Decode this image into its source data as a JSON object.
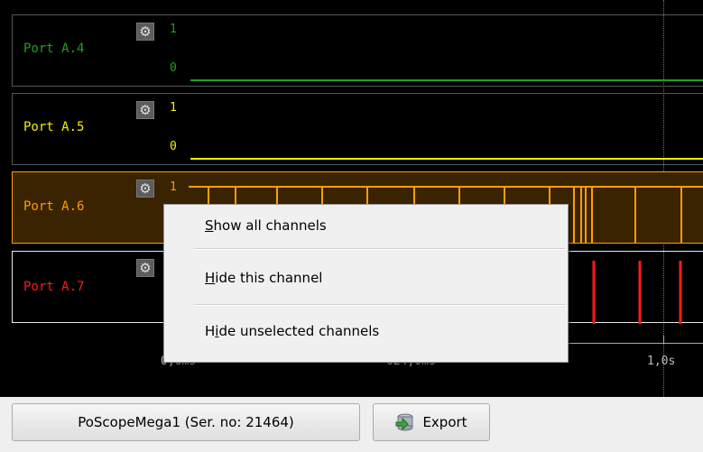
{
  "channels": [
    {
      "label": "Port A.4",
      "color": "#1f9f1f",
      "level_high": "1",
      "level_low": "0"
    },
    {
      "label": "Port A.5",
      "color": "#f0f000",
      "level_high": "1",
      "level_low": "0"
    },
    {
      "label": "Port A.6",
      "color": "#ff9f00",
      "level_high": "1"
    },
    {
      "label": "Port A.7",
      "color": "#ff1a1a"
    }
  ],
  "axis": {
    "tick_left": "0,0ms",
    "tick_mid": "624,0ms",
    "tick_right": "1,0s"
  },
  "context_menu": {
    "items": [
      {
        "label": "Show all channels",
        "mnemonic": "S"
      },
      {
        "label": "Hide this channel",
        "mnemonic": "H"
      },
      {
        "label": "Hide unselected channels",
        "mnemonic": "i"
      }
    ]
  },
  "bottom_bar": {
    "device_button": "PoScopeMega1 (Ser. no: 21464)",
    "export_button": "Export"
  },
  "icons": {
    "channel_settings": "gear-icon",
    "export": "export-icon"
  }
}
